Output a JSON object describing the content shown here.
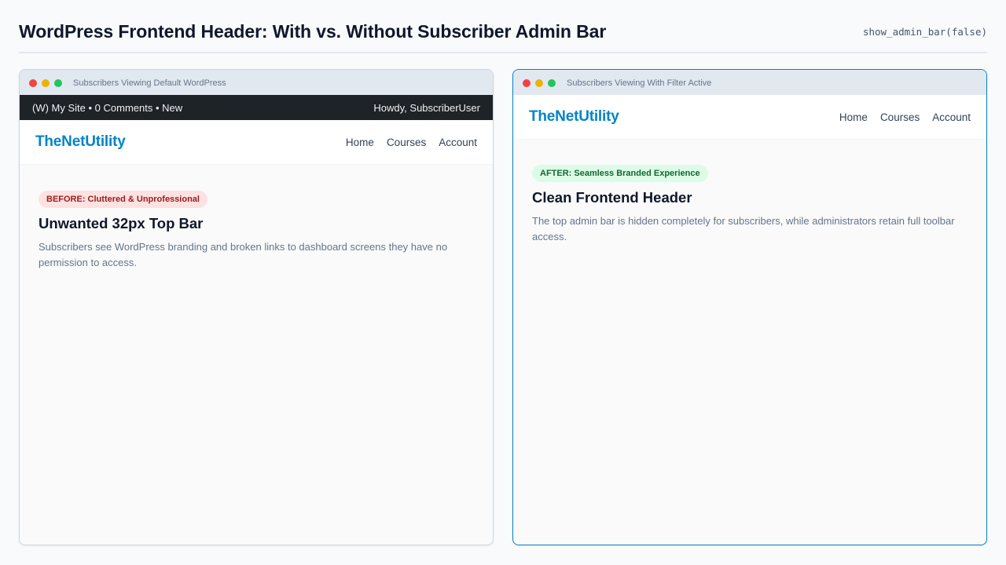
{
  "header": {
    "title": "WordPress Frontend Header: With vs. Without Subscriber Admin Bar",
    "code": "show_admin_bar(false)"
  },
  "before": {
    "window_title": "Subscribers Viewing Default WordPress",
    "admin_bar": {
      "left": "(W) My Site • 0 Comments • New",
      "right": "Howdy, SubscriberUser"
    },
    "logo": "TheNetUtility",
    "nav": [
      "Home",
      "Courses",
      "Account"
    ],
    "badge": "BEFORE: Cluttered & Unprofessional",
    "heading": "Unwanted 32px Top Bar",
    "text": "Subscribers see WordPress branding and broken links to dashboard screens they have no permission to access."
  },
  "after": {
    "window_title": "Subscribers Viewing With Filter Active",
    "logo": "TheNetUtility",
    "nav": [
      "Home",
      "Courses",
      "Account"
    ],
    "badge": "AFTER: Seamless Branded Experience",
    "heading": "Clean Frontend Header",
    "text": "The top admin bar is hidden completely for subscribers, while administrators retain full toolbar access."
  },
  "colors": {
    "brand": "#0284c7",
    "admin_bar": "#1d2327",
    "before_badge_bg": "#fee2e2",
    "before_badge_text": "#991b1b",
    "after_badge_bg": "#dcfce7",
    "after_badge_text": "#166534"
  }
}
